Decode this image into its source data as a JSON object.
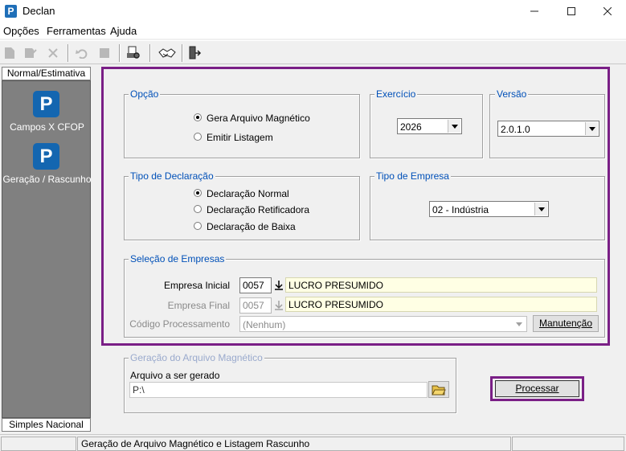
{
  "window": {
    "title": "Declan",
    "app_icon_letter": "P"
  },
  "menu": [
    "Opções",
    "Ferramentas",
    "Ajuda"
  ],
  "left_panel": {
    "header": "Normal/Estimativa",
    "items": [
      {
        "label": "Campos X CFOP",
        "icon": "P"
      },
      {
        "label": "Geração / Rascunho",
        "icon": "P"
      }
    ],
    "footer": "Simples Nacional"
  },
  "opcao": {
    "title": "Opção",
    "options": [
      "Gera Arquivo Magnético",
      "Emitir Listagem"
    ],
    "selected_index": 0
  },
  "exercicio": {
    "title": "Exercício",
    "value": "2026"
  },
  "versao": {
    "title": "Versão",
    "value": "2.0.1.0"
  },
  "tipo_declaracao": {
    "title": "Tipo de Declaração",
    "options": [
      "Declaração Normal",
      "Declaração Retificadora",
      "Declaração de Baixa"
    ],
    "selected_index": 0
  },
  "tipo_empresa": {
    "title": "Tipo de Empresa",
    "value": "02 - Indústria"
  },
  "selecao": {
    "title": "Seleção de Empresas",
    "empresa_inicial": {
      "label": "Empresa Inicial",
      "code": "0057",
      "name": "LUCRO PRESUMIDO"
    },
    "empresa_final": {
      "label": "Empresa Final",
      "code": "0057",
      "name": "LUCRO PRESUMIDO"
    },
    "codigo_processamento": {
      "label": "Código Processamento",
      "value": "(Nenhum)"
    },
    "manutencao_label": "Manutenção"
  },
  "geracao": {
    "title": "Geração do Arquivo Magnético",
    "arquivo_label": "Arquivo a ser gerado",
    "arquivo_value": "P:\\"
  },
  "processar_label": "Processar",
  "status": {
    "text": "Geração de Arquivo Magnético e Listagem Rascunho"
  },
  "colors": {
    "accent_frame": "#7a1f86",
    "group_title": "#0050b8",
    "highlight_field": "#ffffe4"
  }
}
